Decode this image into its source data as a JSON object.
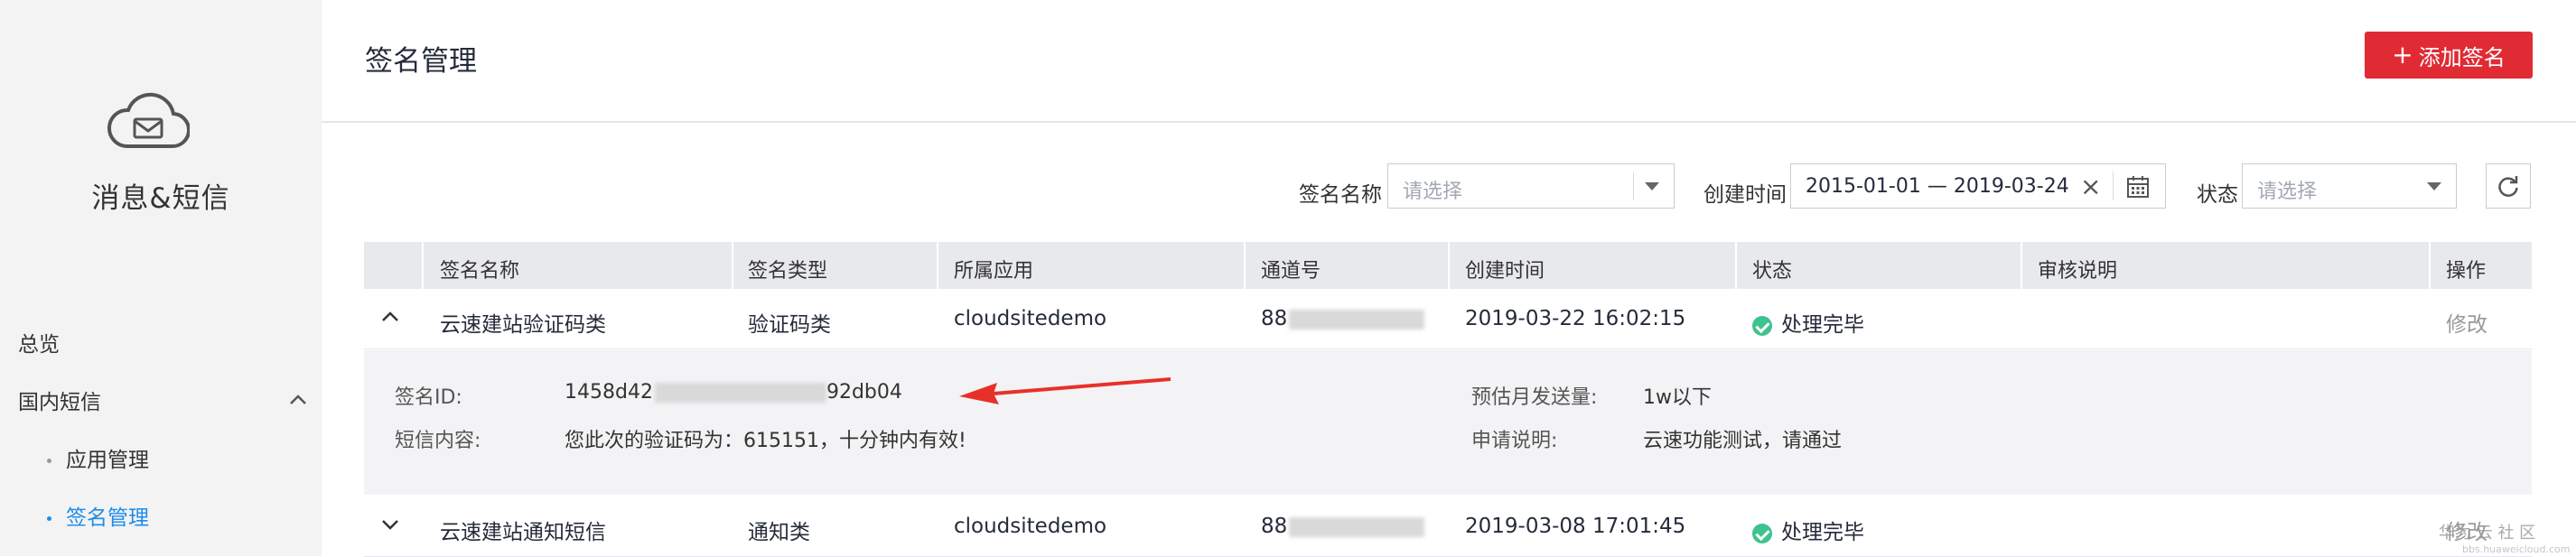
{
  "sidebar": {
    "product_title": "消息&短信",
    "overview": "总览",
    "domestic_sms": "国内短信",
    "sub_items": [
      "应用管理",
      "签名管理"
    ]
  },
  "header": {
    "title": "签名管理",
    "add_button": "添加签名"
  },
  "filters": {
    "sign_name_label": "签名名称",
    "sign_name_placeholder": "请选择",
    "created_label": "创建时间",
    "date_range": "2015-01-01 — 2019-03-24",
    "status_label": "状态",
    "status_placeholder": "请选择"
  },
  "table": {
    "columns": [
      "签名名称",
      "签名类型",
      "所属应用",
      "通道号",
      "创建时间",
      "状态",
      "审核说明",
      "操作"
    ],
    "rows": [
      {
        "name": "云速建站验证码类",
        "type": "验证码类",
        "app": "cloudsitedemo",
        "channel": "88",
        "created": "2019-03-22 16:02:15",
        "status": "处理完毕",
        "review": "",
        "action": "修改"
      },
      {
        "name": "云速建站通知短信",
        "type": "通知类",
        "app": "cloudsitedemo",
        "channel": "88",
        "created": "2019-03-08 17:01:45",
        "status": "处理完毕",
        "review": "",
        "action": "修改"
      }
    ],
    "detail": {
      "sign_id_label": "签名ID:",
      "sign_id_start": "1458d42",
      "sign_id_end": "92db04",
      "content_label": "短信内容:",
      "content": "您此次的验证码为：615151，十分钟内有效!",
      "monthly_label": "预估月发送量:",
      "monthly": "1w以下",
      "apply_label": "申请说明:",
      "apply": "云速功能测试，请通过"
    }
  },
  "watermark": {
    "brand": "华为 云 社 区",
    "url": "bbs.huaweicloud.com"
  },
  "colors": {
    "accent_red": "#e02b35",
    "link_blue": "#1f8ceb",
    "status_green": "#3ec28f",
    "arrow_red": "#e8302a"
  }
}
